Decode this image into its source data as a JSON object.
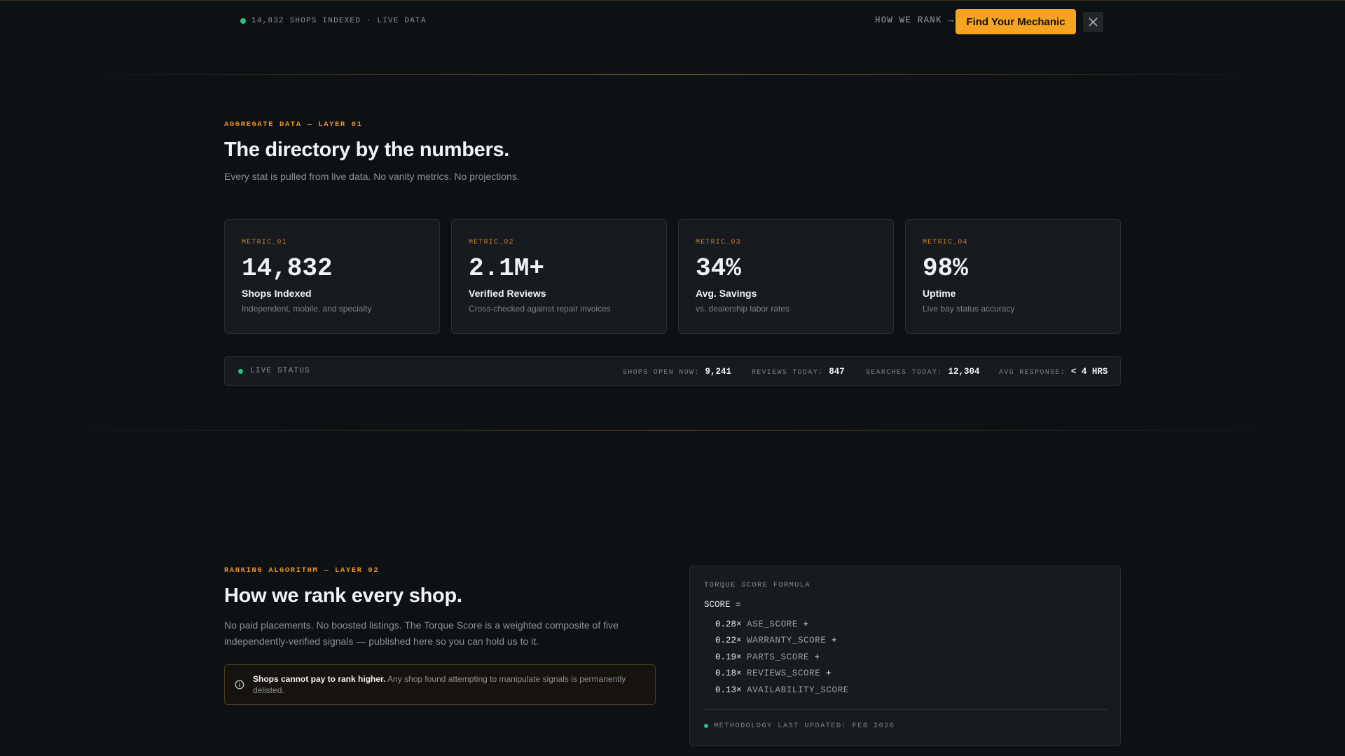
{
  "topbar": {
    "live_text": "14,832 SHOPS INDEXED · LIVE DATA",
    "how_we_rank": "HOW WE RANK →",
    "cta_label": "Find Your Mechanic",
    "status_color": "#22c583",
    "accent_color": "#f5a320"
  },
  "layer1": {
    "eyebrow": "AGGREGATE DATA — LAYER 01",
    "title": "The directory by the numbers.",
    "subtitle": "Every stat is pulled from live data. No vanity metrics. No projections.",
    "metrics": [
      {
        "label": "METRIC_01",
        "value": "14,832",
        "title": "Shops Indexed",
        "desc": "Independent, mobile, and specialty"
      },
      {
        "label": "METRIC_02",
        "value": "2.1M+",
        "title": "Verified Reviews",
        "desc": "Cross-checked against repair invoices"
      },
      {
        "label": "METRIC_03",
        "value": "34%",
        "title": "Avg. Savings",
        "desc": "vs. dealership labor rates"
      },
      {
        "label": "METRIC_04",
        "value": "98%",
        "title": "Uptime",
        "desc": "Live bay status accuracy"
      }
    ],
    "status": {
      "label": "LIVE STATUS",
      "items": [
        {
          "key": "SHOPS OPEN NOW:",
          "value": "9,241"
        },
        {
          "key": "REVIEWS TODAY:",
          "value": "847"
        },
        {
          "key": "SEARCHES TODAY:",
          "value": "12,304"
        },
        {
          "key": "AVG RESPONSE:",
          "value": "< 4 HRS"
        }
      ]
    }
  },
  "layer2": {
    "eyebrow": "RANKING ALGORITHM — LAYER 02",
    "title": "How we rank every shop.",
    "lead_line1": "No paid placements. No boosted listings. The Torque Score is a weighted composite of five",
    "lead_line2": "independently-verified signals — published here so you can hold us to it.",
    "notice_bold": "Shops cannot pay to rank higher.",
    "notice_text": "Any shop found attempting to manipulate signals is permanently delisted.",
    "formula": {
      "title": "TORQUE SCORE FORMULA",
      "score": "SCORE =",
      "rows": [
        {
          "weight": "0.28×",
          "name": "ASE_SCORE",
          "op": "+"
        },
        {
          "weight": "0.22×",
          "name": "WARRANTY_SCORE",
          "op": "+"
        },
        {
          "weight": "0.19×",
          "name": "PARTS_SCORE",
          "op": "+"
        },
        {
          "weight": "0.18×",
          "name": "REVIEWS_SCORE",
          "op": "+"
        },
        {
          "weight": "0.13×",
          "name": "AVAILABILITY_SCORE",
          "op": ""
        }
      ],
      "footer": "METHODOLOGY LAST UPDATED: FEB 2026"
    }
  }
}
